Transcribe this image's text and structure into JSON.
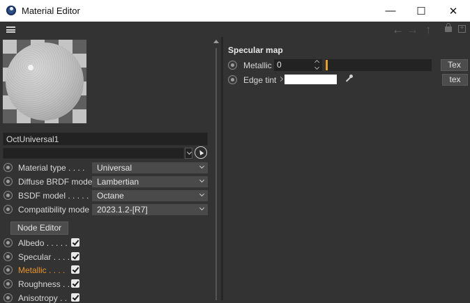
{
  "window": {
    "title": "Material Editor",
    "controls": {
      "minimize": "—",
      "maximize": "☐",
      "close": "✕"
    }
  },
  "menubar": {
    "icons": [
      "menu-icon",
      "back-arrow-icon",
      "forward-arrow-icon",
      "up-arrow-icon",
      "lock-icon",
      "new-window-icon"
    ]
  },
  "material": {
    "name": "OctUniversal1",
    "sub_value": "",
    "properties": [
      {
        "label": "Material type . . . .",
        "value": "Universal"
      },
      {
        "label": "Diffuse BRDF model",
        "value": "Lambertian"
      },
      {
        "label": "BSDF model . . . . .",
        "value": "Octane"
      },
      {
        "label": "Compatibility mode",
        "value": "2023.1.2-[R7]"
      }
    ],
    "node_editor_label": "Node Editor",
    "channels": [
      {
        "label": "Albedo . . . . .",
        "checked": true,
        "active": false
      },
      {
        "label": "Specular . . . .",
        "checked": true,
        "active": false
      },
      {
        "label": "Metallic  . . . .",
        "checked": true,
        "active": true
      },
      {
        "label": "Roughness . .",
        "checked": true,
        "active": false
      },
      {
        "label": "Anisotropy . .",
        "checked": true,
        "active": false
      }
    ]
  },
  "specular_map": {
    "title": "Specular map",
    "metallic": {
      "label": "Metallic",
      "value": "0",
      "button": "Tex"
    },
    "edge_tint": {
      "label": "Edge tint",
      "color": "#ffffff",
      "button": "tex"
    }
  },
  "colors": {
    "background": "#333333",
    "accent_orange": "#e8952a",
    "field": "#222222"
  }
}
